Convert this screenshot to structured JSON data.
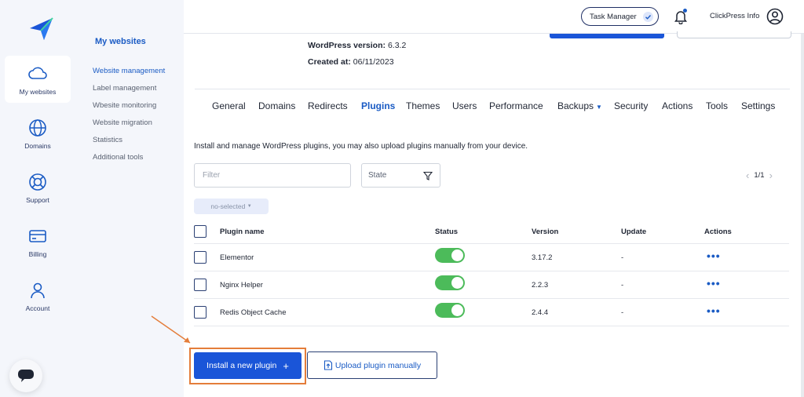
{
  "sidebar": {
    "items": [
      {
        "label": "My websites",
        "icon": "cloud-icon"
      },
      {
        "label": "Domains",
        "icon": "globe-icon"
      },
      {
        "label": "Support",
        "icon": "lifebuoy-icon"
      },
      {
        "label": "Billing",
        "icon": "card-icon"
      },
      {
        "label": "Account",
        "icon": "user-icon"
      }
    ]
  },
  "submenu": {
    "title": "My websites",
    "items": [
      "Website management",
      "Label management",
      "Wbesite monitoring",
      "Website migration",
      "Statistics",
      "Additional tools"
    ]
  },
  "header": {
    "task_manager": "Task Manager",
    "user_name": "ClickPress Info"
  },
  "info": {
    "wp_version_label": "WordPress version:",
    "wp_version": "6.3.2",
    "created_label": "Created at:",
    "created_at": "06/11/2023"
  },
  "tabs": [
    "General",
    "Domains",
    "Redirects",
    "Plugins",
    "Themes",
    "Users",
    "Performance",
    "Backups",
    "Security",
    "Actions",
    "Tools",
    "Settings"
  ],
  "description": "Install and manage WordPress plugins, you may also upload plugins manually from your device.",
  "filter": {
    "placeholder": "Filter",
    "state_label": "State"
  },
  "pager": {
    "text": "1/1"
  },
  "bulk_label": "no-selected",
  "table": {
    "headers": {
      "name": "Plugin name",
      "status": "Status",
      "version": "Version",
      "update": "Update",
      "actions": "Actions"
    },
    "rows": [
      {
        "name": "Elementor",
        "version": "3.17.2",
        "update": "-",
        "active": true
      },
      {
        "name": "Nginx Helper",
        "version": "2.2.3",
        "update": "-",
        "active": true
      },
      {
        "name": "Redis Object Cache",
        "version": "2.4.4",
        "update": "-",
        "active": true
      }
    ]
  },
  "buttons": {
    "install": "Install a new plugin",
    "upload": "Upload plugin manually"
  },
  "colors": {
    "accent": "#1a55d8",
    "toggle_on": "#4cbb5a",
    "highlight": "#e47d3a"
  }
}
